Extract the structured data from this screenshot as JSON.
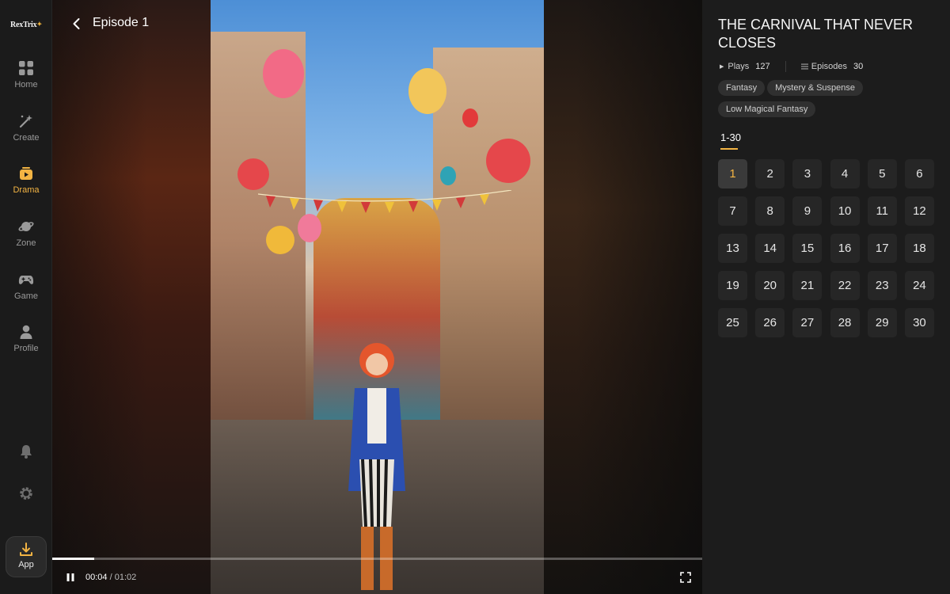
{
  "sidebar": {
    "logo": "RexTrix",
    "items": [
      {
        "label": "Home",
        "icon": "grid-icon"
      },
      {
        "label": "Create",
        "icon": "magic-wand-icon"
      },
      {
        "label": "Drama",
        "icon": "drama-play-icon"
      },
      {
        "label": "Zone",
        "icon": "planet-icon"
      },
      {
        "label": "Game",
        "icon": "gamepad-icon"
      },
      {
        "label": "Profile",
        "icon": "person-icon"
      }
    ],
    "active": "Drama",
    "app_label": "App"
  },
  "player": {
    "episode_title": "Episode 1",
    "current_time": "00:04",
    "separator": " / ",
    "duration": "01:02",
    "progress": 0.065
  },
  "panel": {
    "title": "THE CARNIVAL THAT NEVER CLOSES",
    "plays_label": "Plays",
    "plays": "127",
    "episodes_label": "Episodes",
    "episodes": "30",
    "tags": [
      "Fantasy",
      "Mystery & Suspense",
      "Low Magical Fantasy"
    ],
    "range_tab": "1-30",
    "episode_numbers": [
      "1",
      "2",
      "3",
      "4",
      "5",
      "6",
      "7",
      "8",
      "9",
      "10",
      "11",
      "12",
      "13",
      "14",
      "15",
      "16",
      "17",
      "18",
      "19",
      "20",
      "21",
      "22",
      "23",
      "24",
      "25",
      "26",
      "27",
      "28",
      "29",
      "30"
    ],
    "current_episode": "1"
  },
  "colors": {
    "accent": "#f3b443",
    "panel_bg": "#1c1c1c",
    "sidebar_bg": "#1b1b1b"
  }
}
